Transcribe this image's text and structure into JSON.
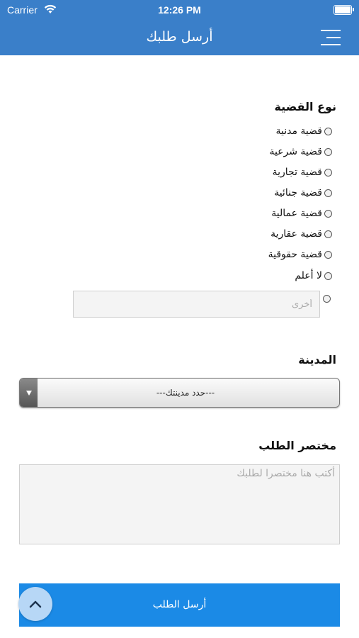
{
  "status_bar": {
    "carrier": "Carrier",
    "time": "12:26 PM"
  },
  "header": {
    "title": "أرسل طلبك"
  },
  "case_type": {
    "label": "نوع القضية",
    "options": [
      "قضية مدنية",
      "قضية شرعية",
      "قضية تجارية",
      "قضية جنائية",
      "قضية عمالية",
      "قضية عقارية",
      "قضية حقوقية",
      "لا أعلم"
    ],
    "other_placeholder": "أخرى"
  },
  "city": {
    "label": "المدينة",
    "selected": "---حدد مدينتك---"
  },
  "summary": {
    "label": "مختصر الطلب",
    "placeholder": "أكتب هنا مختصرا لطلبك"
  },
  "submit": {
    "label": "أرسل الطلب"
  },
  "colors": {
    "header_bg": "#3a7fc9",
    "button_bg": "#1b8ae6",
    "fab_bg": "#b7d7f6"
  },
  "icons": {
    "menu": "hamburger-menu-icon",
    "wifi": "wifi-icon",
    "battery": "battery-icon",
    "scroll_top": "chevron-up-icon"
  }
}
